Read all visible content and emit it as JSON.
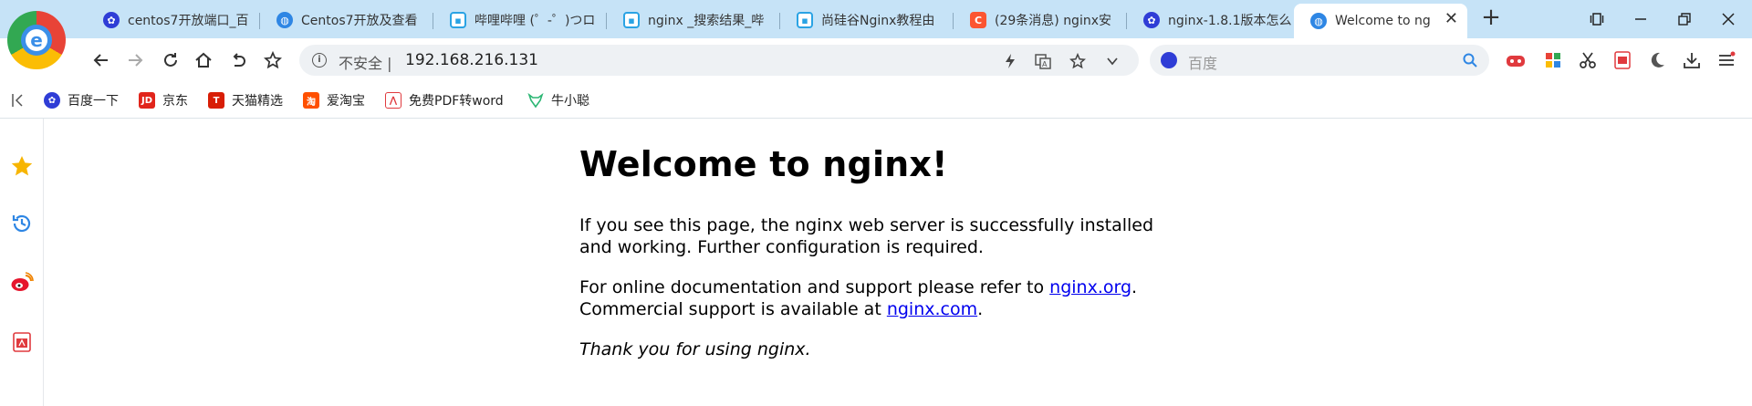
{
  "tabs": [
    {
      "label": "centos7开放端口_百",
      "icon": "baidu-paw-icon"
    },
    {
      "label": "Centos7开放及查看",
      "icon": "globe-icon"
    },
    {
      "label": "哔哩哔哩 (゜-゜)つロ",
      "icon": "bilibili-icon"
    },
    {
      "label": "nginx _搜索结果_哔",
      "icon": "bilibili-icon"
    },
    {
      "label": "尚硅谷Nginx教程由",
      "icon": "bilibili-icon"
    },
    {
      "label": "(29条消息) nginx安",
      "icon": "csdn-icon"
    },
    {
      "label": "nginx-1.8.1版本怎么",
      "icon": "baidu-paw-icon"
    },
    {
      "label": "Welcome to ng",
      "icon": "globe-icon"
    }
  ],
  "address": {
    "security_label": "不安全",
    "separator": "|",
    "url": "192.168.216.131"
  },
  "search": {
    "placeholder": "百度"
  },
  "bookmarks": [
    {
      "label": "百度一下",
      "icon": "baidu-paw-icon"
    },
    {
      "label": "京东",
      "icon": "jd-icon"
    },
    {
      "label": "天猫精选",
      "icon": "tmall-icon"
    },
    {
      "label": "爱淘宝",
      "icon": "taobao-icon"
    },
    {
      "label": "免费PDF转word",
      "icon": "pdf-icon"
    },
    {
      "label": "牛小聪",
      "icon": "bull-icon"
    }
  ],
  "content": {
    "title": "Welcome to nginx!",
    "para1": "If you see this page, the nginx web server is successfully installed and working. Further configuration is required.",
    "para2_prefix": "For online documentation and support please refer to ",
    "link1": "nginx.org",
    "para2_mid": ".",
    "para2_line2": "Commercial support is available at ",
    "link2": "nginx.com",
    "para2_end": ".",
    "thanks": "Thank you for using nginx."
  },
  "colors": {
    "tabbar_bg": "#c6e3f7",
    "link": "#0000ee",
    "accent": "#2e86e4"
  },
  "browser_logo_letter": "e"
}
